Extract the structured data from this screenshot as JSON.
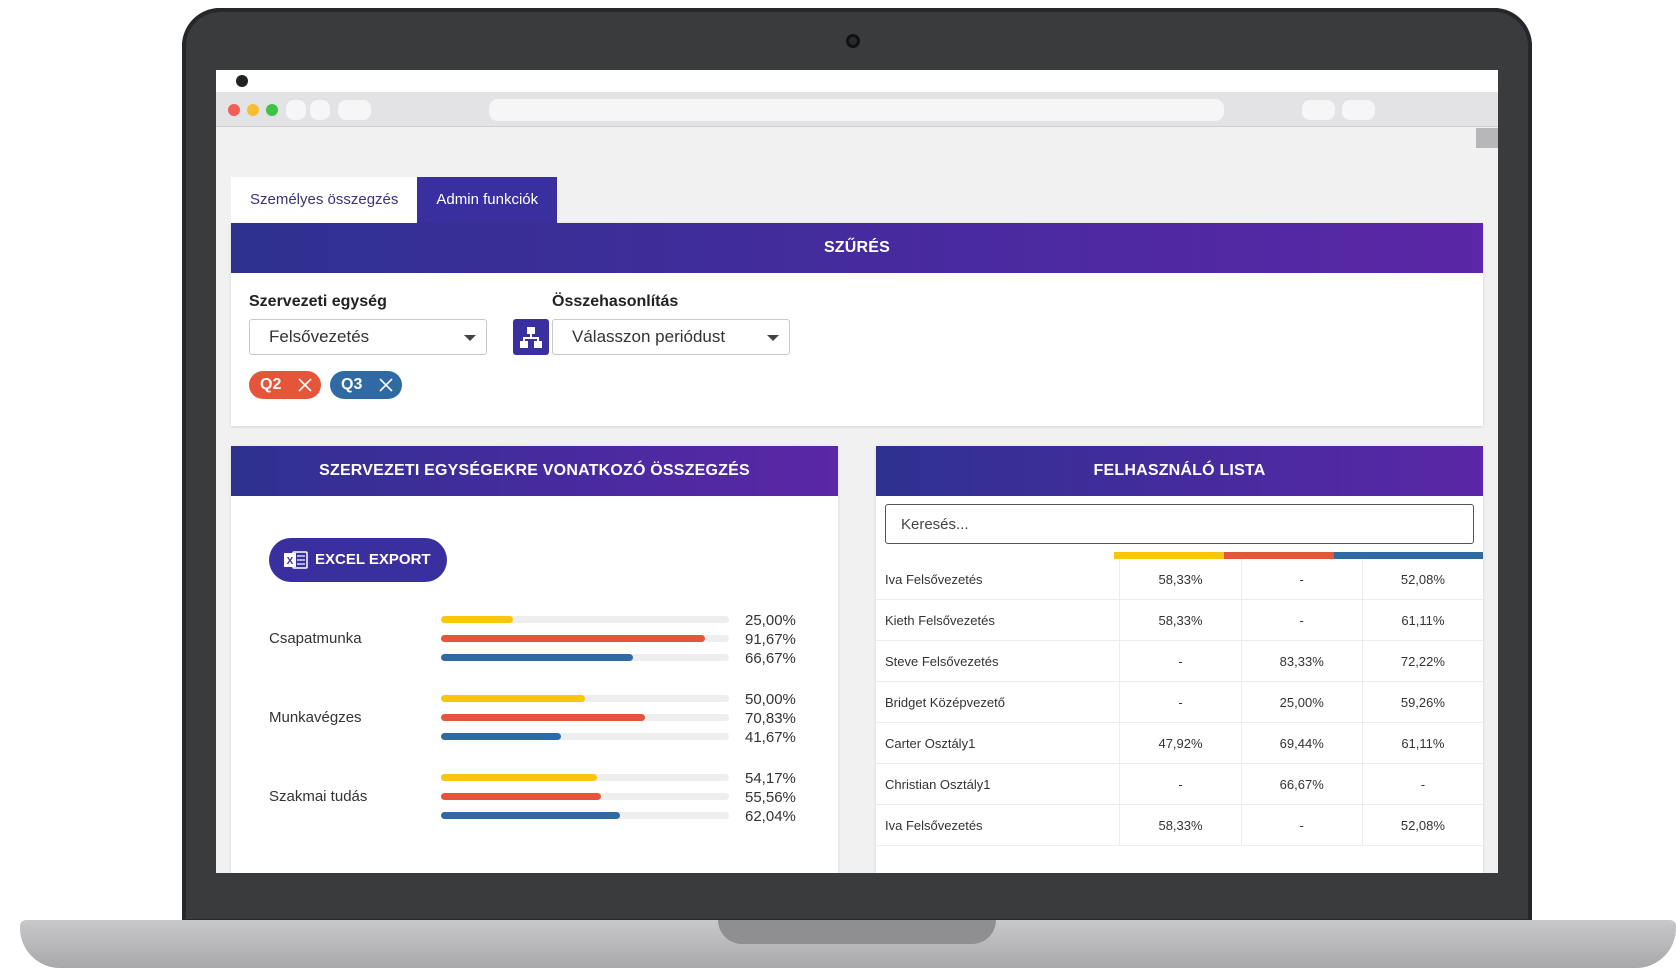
{
  "tabs": [
    {
      "label": "Személyes összegzés",
      "active": false
    },
    {
      "label": "Admin funkciók",
      "active": true
    }
  ],
  "filter": {
    "title": "SZŰRÉS",
    "org_unit_label": "Szervezeti egység",
    "org_unit_value": "Felsővezetés",
    "comparison_label": "Összehasonlítás",
    "comparison_placeholder": "Válasszon periódust",
    "chips": [
      {
        "label": "Q2",
        "color": "#e4553a"
      },
      {
        "label": "Q3",
        "color": "#2f6aa3"
      }
    ]
  },
  "summary": {
    "title": "SZERVEZETI EGYSÉGEKRE VONATKOZÓ ÖSSZEGZÉS",
    "export_label": "EXCEL EXPORT",
    "series_colors": [
      "#f8c60a",
      "#e4553a",
      "#2f6aa3"
    ],
    "metrics": [
      {
        "label": "Csapatmunka",
        "values": [
          "25,00%",
          "91,67%",
          "66,67%"
        ],
        "fractions": [
          0.25,
          0.9167,
          0.6667
        ]
      },
      {
        "label": "Munkavégzes",
        "values": [
          "50,00%",
          "70,83%",
          "41,67%"
        ],
        "fractions": [
          0.5,
          0.7083,
          0.4167
        ]
      },
      {
        "label": "Szakmai tudás",
        "values": [
          "54,17%",
          "55,56%",
          "62,04%"
        ],
        "fractions": [
          0.5417,
          0.5556,
          0.6204
        ]
      }
    ]
  },
  "users": {
    "title": "FELHASZNÁLÓ LISTA",
    "search_placeholder": "Keresés...",
    "column_colors": [
      "#f8c60a",
      "#e4553a",
      "#2f6aa3"
    ],
    "rows": [
      {
        "name": "Iva Felsővezetés",
        "v1": "58,33%",
        "v2": "-",
        "v3": "52,08%"
      },
      {
        "name": "Kieth Felsővezetés",
        "v1": "58,33%",
        "v2": "-",
        "v3": "61,11%"
      },
      {
        "name": "Steve Felsővezetés",
        "v1": "-",
        "v2": "83,33%",
        "v3": "72,22%"
      },
      {
        "name": "Bridget Középvezető",
        "v1": "-",
        "v2": "25,00%",
        "v3": "59,26%"
      },
      {
        "name": "Carter Osztály1",
        "v1": "47,92%",
        "v2": "69,44%",
        "v3": "61,11%"
      },
      {
        "name": "Christian Osztály1",
        "v1": "-",
        "v2": "66,67%",
        "v3": "-"
      },
      {
        "name": "Iva Felsővezetés",
        "v1": "58,33%",
        "v2": "-",
        "v3": "52,08%"
      }
    ]
  }
}
